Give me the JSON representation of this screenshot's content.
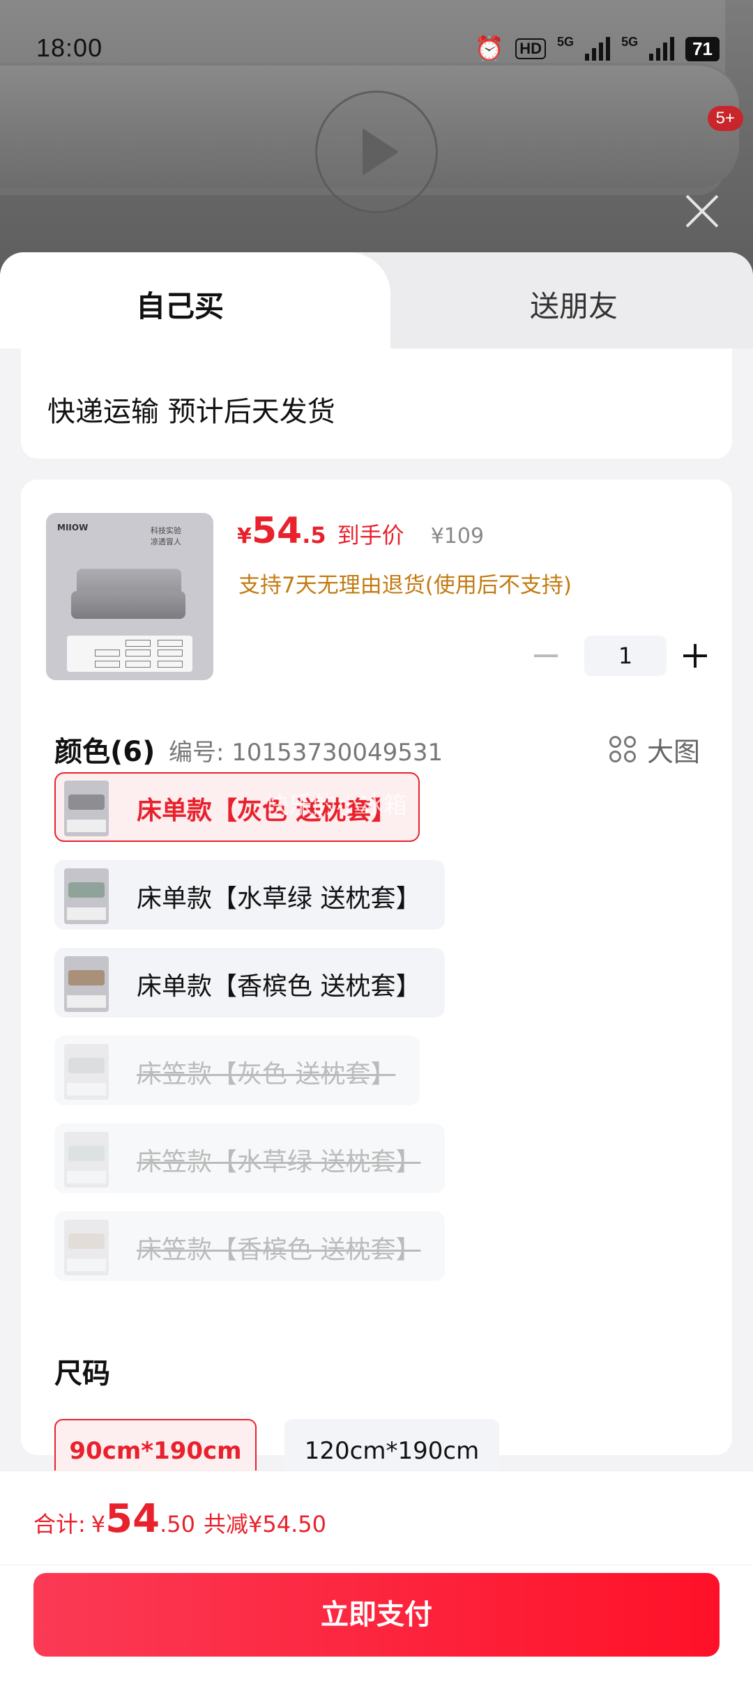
{
  "status_bar": {
    "time": "18:00",
    "hd_label": "HD",
    "net1": "5G",
    "net2": "5G",
    "battery": "71",
    "notification_badge": "5+"
  },
  "tabs": [
    {
      "label": "自己买",
      "active": true
    },
    {
      "label": "送朋友",
      "active": false
    }
  ],
  "shipping": {
    "text": "快递运输 预计后天发货"
  },
  "product": {
    "thumb_logo": "MIIOW",
    "thumb_headline_1": "科技实验",
    "thumb_headline_2": "凉透冒人",
    "price_symbol": "¥",
    "price_int": "54",
    "price_dec": ".5",
    "price_tag": "到手价",
    "original_price": "¥109",
    "support_text": "支持7天无理由退货(使用后不支持)"
  },
  "quantity": {
    "value": "1"
  },
  "color_section": {
    "title": "颜色(6)",
    "code": "编号: 10153730049531",
    "big_image_label": "大图",
    "watermark": "快乐的小冰箱",
    "options": [
      {
        "label": "床单款【灰色 送枕套】",
        "state": "selected",
        "color": "#8e8e92"
      },
      {
        "label": "床单款【水草绿 送枕套】",
        "state": "normal",
        "color": "#8fa39a"
      },
      {
        "label": "床单款【香槟色 送枕套】",
        "state": "normal",
        "color": "#a8907a"
      },
      {
        "label": "床笠款【灰色 送枕套】",
        "state": "disabled",
        "color": "#8e8e92"
      },
      {
        "label": "床笠款【水草绿 送枕套】",
        "state": "disabled",
        "color": "#8fa39a"
      },
      {
        "label": "床笠款【香槟色 送枕套】",
        "state": "disabled",
        "color": "#a8907a"
      }
    ]
  },
  "size_section": {
    "title": "尺码",
    "options": [
      {
        "label": "90cm*190cm",
        "state": "selected"
      },
      {
        "label": "120cm*190cm",
        "state": "normal"
      }
    ]
  },
  "footer": {
    "total_label": "合计:",
    "total_symbol": "¥",
    "total_int": "54",
    "total_dec": ".50",
    "saving_text": "共减¥54.50",
    "pay_button": "立即支付"
  },
  "colors": {
    "accent": "#e8212c",
    "pay_gradient_start": "#fb3a55",
    "pay_gradient_end": "#fe1128",
    "support_text": "#c27b12"
  }
}
